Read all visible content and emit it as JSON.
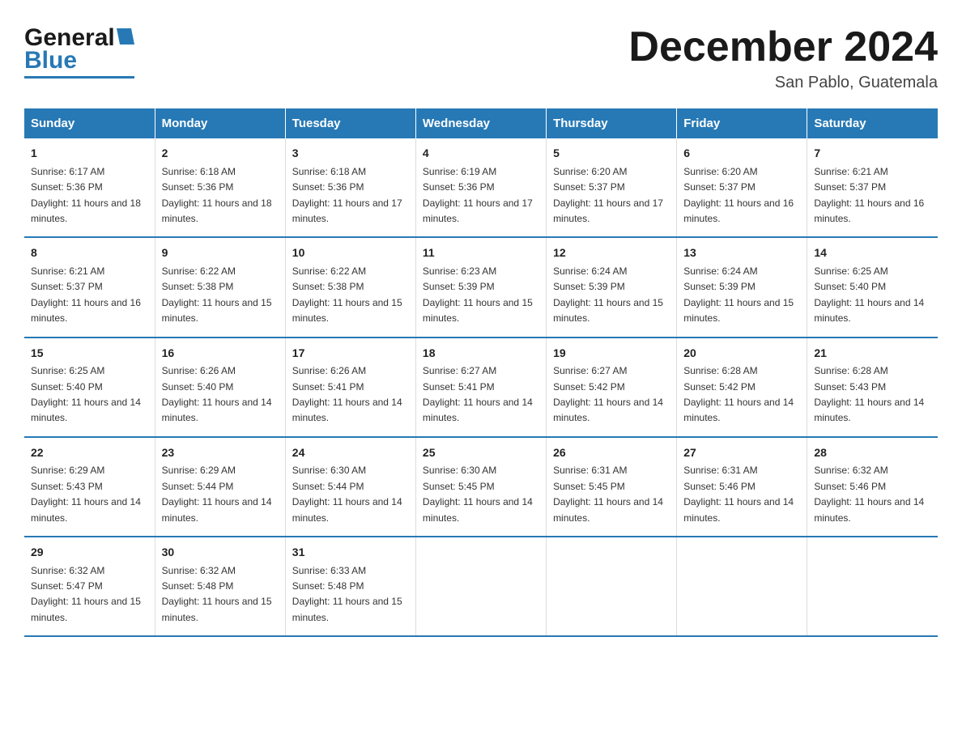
{
  "header": {
    "logo_general": "General",
    "logo_blue": "Blue",
    "month_title": "December 2024",
    "location": "San Pablo, Guatemala"
  },
  "days_of_week": [
    "Sunday",
    "Monday",
    "Tuesday",
    "Wednesday",
    "Thursday",
    "Friday",
    "Saturday"
  ],
  "weeks": [
    [
      {
        "day": "1",
        "sunrise": "6:17 AM",
        "sunset": "5:36 PM",
        "daylight": "11 hours and 18 minutes."
      },
      {
        "day": "2",
        "sunrise": "6:18 AM",
        "sunset": "5:36 PM",
        "daylight": "11 hours and 18 minutes."
      },
      {
        "day": "3",
        "sunrise": "6:18 AM",
        "sunset": "5:36 PM",
        "daylight": "11 hours and 17 minutes."
      },
      {
        "day": "4",
        "sunrise": "6:19 AM",
        "sunset": "5:36 PM",
        "daylight": "11 hours and 17 minutes."
      },
      {
        "day": "5",
        "sunrise": "6:20 AM",
        "sunset": "5:37 PM",
        "daylight": "11 hours and 17 minutes."
      },
      {
        "day": "6",
        "sunrise": "6:20 AM",
        "sunset": "5:37 PM",
        "daylight": "11 hours and 16 minutes."
      },
      {
        "day": "7",
        "sunrise": "6:21 AM",
        "sunset": "5:37 PM",
        "daylight": "11 hours and 16 minutes."
      }
    ],
    [
      {
        "day": "8",
        "sunrise": "6:21 AM",
        "sunset": "5:37 PM",
        "daylight": "11 hours and 16 minutes."
      },
      {
        "day": "9",
        "sunrise": "6:22 AM",
        "sunset": "5:38 PM",
        "daylight": "11 hours and 15 minutes."
      },
      {
        "day": "10",
        "sunrise": "6:22 AM",
        "sunset": "5:38 PM",
        "daylight": "11 hours and 15 minutes."
      },
      {
        "day": "11",
        "sunrise": "6:23 AM",
        "sunset": "5:39 PM",
        "daylight": "11 hours and 15 minutes."
      },
      {
        "day": "12",
        "sunrise": "6:24 AM",
        "sunset": "5:39 PM",
        "daylight": "11 hours and 15 minutes."
      },
      {
        "day": "13",
        "sunrise": "6:24 AM",
        "sunset": "5:39 PM",
        "daylight": "11 hours and 15 minutes."
      },
      {
        "day": "14",
        "sunrise": "6:25 AM",
        "sunset": "5:40 PM",
        "daylight": "11 hours and 14 minutes."
      }
    ],
    [
      {
        "day": "15",
        "sunrise": "6:25 AM",
        "sunset": "5:40 PM",
        "daylight": "11 hours and 14 minutes."
      },
      {
        "day": "16",
        "sunrise": "6:26 AM",
        "sunset": "5:40 PM",
        "daylight": "11 hours and 14 minutes."
      },
      {
        "day": "17",
        "sunrise": "6:26 AM",
        "sunset": "5:41 PM",
        "daylight": "11 hours and 14 minutes."
      },
      {
        "day": "18",
        "sunrise": "6:27 AM",
        "sunset": "5:41 PM",
        "daylight": "11 hours and 14 minutes."
      },
      {
        "day": "19",
        "sunrise": "6:27 AM",
        "sunset": "5:42 PM",
        "daylight": "11 hours and 14 minutes."
      },
      {
        "day": "20",
        "sunrise": "6:28 AM",
        "sunset": "5:42 PM",
        "daylight": "11 hours and 14 minutes."
      },
      {
        "day": "21",
        "sunrise": "6:28 AM",
        "sunset": "5:43 PM",
        "daylight": "11 hours and 14 minutes."
      }
    ],
    [
      {
        "day": "22",
        "sunrise": "6:29 AM",
        "sunset": "5:43 PM",
        "daylight": "11 hours and 14 minutes."
      },
      {
        "day": "23",
        "sunrise": "6:29 AM",
        "sunset": "5:44 PM",
        "daylight": "11 hours and 14 minutes."
      },
      {
        "day": "24",
        "sunrise": "6:30 AM",
        "sunset": "5:44 PM",
        "daylight": "11 hours and 14 minutes."
      },
      {
        "day": "25",
        "sunrise": "6:30 AM",
        "sunset": "5:45 PM",
        "daylight": "11 hours and 14 minutes."
      },
      {
        "day": "26",
        "sunrise": "6:31 AM",
        "sunset": "5:45 PM",
        "daylight": "11 hours and 14 minutes."
      },
      {
        "day": "27",
        "sunrise": "6:31 AM",
        "sunset": "5:46 PM",
        "daylight": "11 hours and 14 minutes."
      },
      {
        "day": "28",
        "sunrise": "6:32 AM",
        "sunset": "5:46 PM",
        "daylight": "11 hours and 14 minutes."
      }
    ],
    [
      {
        "day": "29",
        "sunrise": "6:32 AM",
        "sunset": "5:47 PM",
        "daylight": "11 hours and 15 minutes."
      },
      {
        "day": "30",
        "sunrise": "6:32 AM",
        "sunset": "5:48 PM",
        "daylight": "11 hours and 15 minutes."
      },
      {
        "day": "31",
        "sunrise": "6:33 AM",
        "sunset": "5:48 PM",
        "daylight": "11 hours and 15 minutes."
      },
      {
        "day": "",
        "sunrise": "",
        "sunset": "",
        "daylight": ""
      },
      {
        "day": "",
        "sunrise": "",
        "sunset": "",
        "daylight": ""
      },
      {
        "day": "",
        "sunrise": "",
        "sunset": "",
        "daylight": ""
      },
      {
        "day": "",
        "sunrise": "",
        "sunset": "",
        "daylight": ""
      }
    ]
  ],
  "labels": {
    "sunrise_prefix": "Sunrise: ",
    "sunset_prefix": "Sunset: ",
    "daylight_prefix": "Daylight: "
  }
}
